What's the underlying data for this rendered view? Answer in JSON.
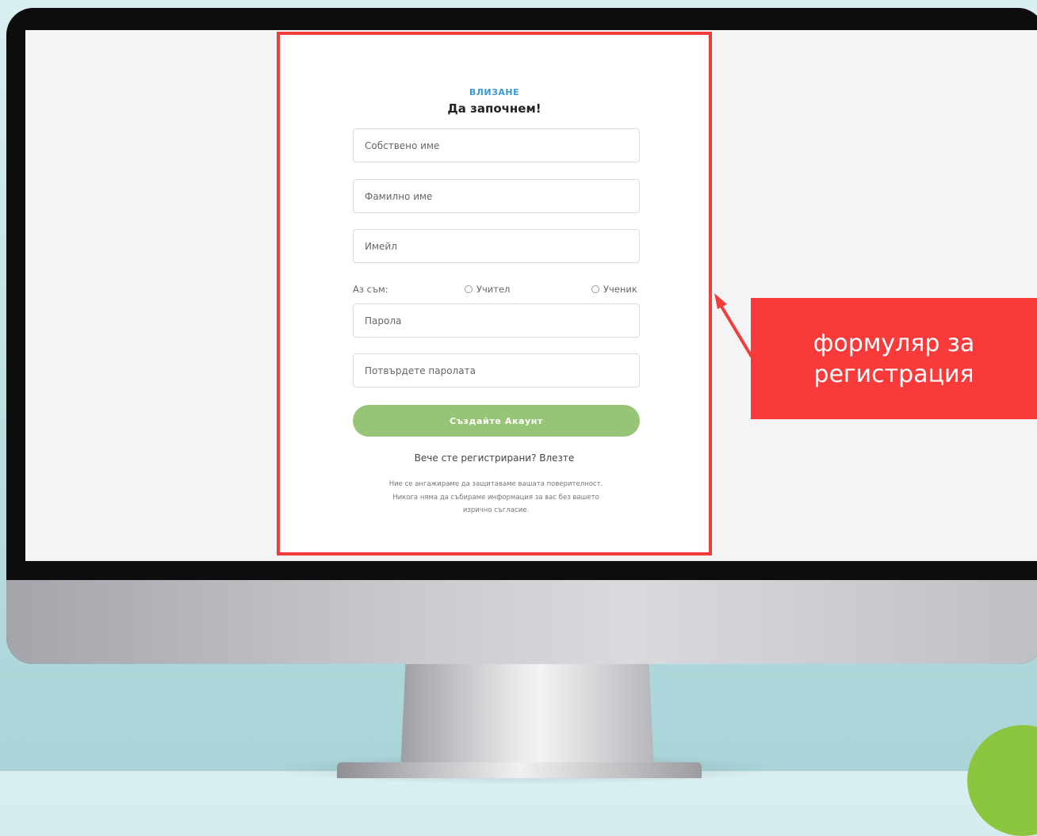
{
  "form": {
    "eyebrow": "ВЛИЗАНЕ",
    "title": "Да започнем!",
    "fields": {
      "first_name_placeholder": "Собствено име",
      "last_name_placeholder": "Фамилно име",
      "email_placeholder": "Имейл",
      "password_placeholder": "Парола",
      "confirm_password_placeholder": "Потвърдете паролата"
    },
    "role": {
      "label": "Аз съм:",
      "option_teacher": "Учител",
      "option_student": "Ученик"
    },
    "submit_label": "Създайте Акаунт",
    "login_prompt": "Вече сте регистрирани? Влезте",
    "privacy_line1": "Ние се ангажираме да защитаваме вашата поверителност.",
    "privacy_line2": "Никога няма да събираме информация за вас без вашето",
    "privacy_line3": "изрично съгласие."
  },
  "callout": {
    "text_line1": "формуляр за",
    "text_line2": "регистрация"
  },
  "colors": {
    "highlight_red": "#f23b3b",
    "button_green": "#97c477",
    "eyebrow_blue": "#3a98d6"
  }
}
